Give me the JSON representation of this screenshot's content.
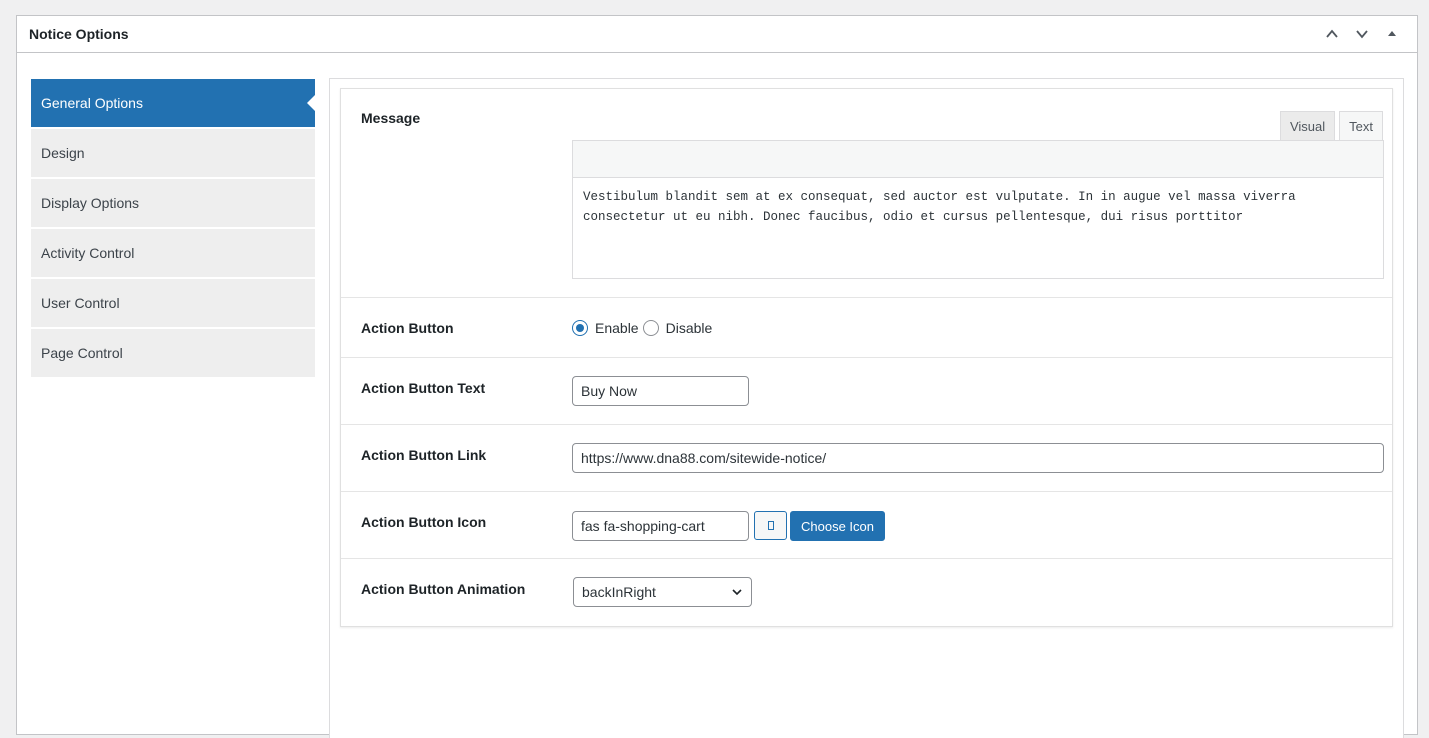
{
  "postbox": {
    "title": "Notice Options"
  },
  "sidebar": {
    "items": [
      {
        "label": "General Options",
        "active": true
      },
      {
        "label": "Design"
      },
      {
        "label": "Display Options"
      },
      {
        "label": "Activity Control"
      },
      {
        "label": "User Control"
      },
      {
        "label": "Page Control"
      }
    ]
  },
  "fields": {
    "message": {
      "label": "Message",
      "tab_visual": "Visual",
      "tab_text": "Text",
      "value": "Vestibulum blandit sem at ex consequat, sed auctor est vulputate. In in augue vel massa viverra consectetur ut eu nibh. Donec faucibus, odio et cursus pellentesque, dui risus porttitor"
    },
    "action_button": {
      "label": "Action Button",
      "enable_label": "Enable",
      "disable_label": "Disable",
      "selected": "Enable"
    },
    "action_button_text": {
      "label": "Action Button Text",
      "value": "Buy Now"
    },
    "action_button_link": {
      "label": "Action Button Link",
      "value": "https://www.dna88.com/sitewide-notice/"
    },
    "action_button_icon": {
      "label": "Action Button Icon",
      "value": "fas fa-shopping-cart",
      "choose_label": "Choose Icon"
    },
    "action_button_animation": {
      "label": "Action Button Animation",
      "value": "backInRight"
    }
  },
  "colors": {
    "accent": "#2271b1",
    "sidebar_bg": "#eeeeee"
  }
}
